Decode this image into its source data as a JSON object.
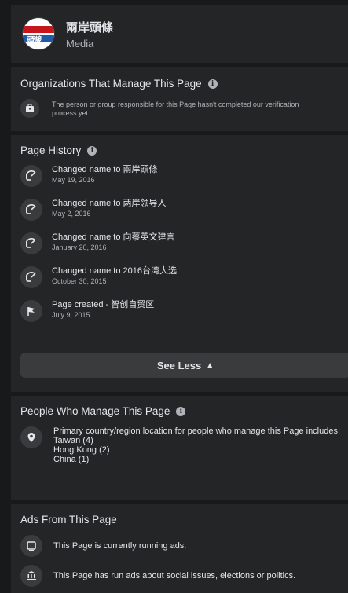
{
  "header": {
    "page_name": "兩岸頭條",
    "category": "Media",
    "logo_text": "頭條"
  },
  "organizations": {
    "title": "Organizations That Manage This Page",
    "message": "The person or group responsible for this Page hasn't completed our verification process yet."
  },
  "history": {
    "title": "Page History",
    "items": [
      {
        "text": "Changed name to 兩岸頭條",
        "date": "May 19, 2016",
        "icon": "rename-icon"
      },
      {
        "text": "Changed name to 两岸领导人",
        "date": "May 2, 2016",
        "icon": "rename-icon"
      },
      {
        "text": "Changed name to 向蔡英文建言",
        "date": "January 20, 2016",
        "icon": "rename-icon"
      },
      {
        "text": "Changed name to 2016台湾大选",
        "date": "October 30, 2015",
        "icon": "rename-icon"
      },
      {
        "text": "Page created - 智创自贸区",
        "date": "July 9, 2015",
        "icon": "flag-icon"
      }
    ],
    "see_less": "See Less"
  },
  "people": {
    "title": "People Who Manage This Page",
    "intro": "Primary country/region location for people who manage this Page includes:",
    "locations": [
      "Taiwan (4)",
      "Hong Kong (2)",
      "China (1)"
    ]
  },
  "ads": {
    "title": "Ads From This Page",
    "items": [
      {
        "text": "This Page is currently running ads.",
        "icon": "monitor-icon"
      },
      {
        "text": "This Page has run ads about social issues, elections or politics.",
        "icon": "institution-icon"
      }
    ]
  },
  "colors": {
    "background": "#18191a",
    "card": "#242526",
    "secondary_text": "#b0b3b8",
    "button": "#3a3b3c"
  }
}
